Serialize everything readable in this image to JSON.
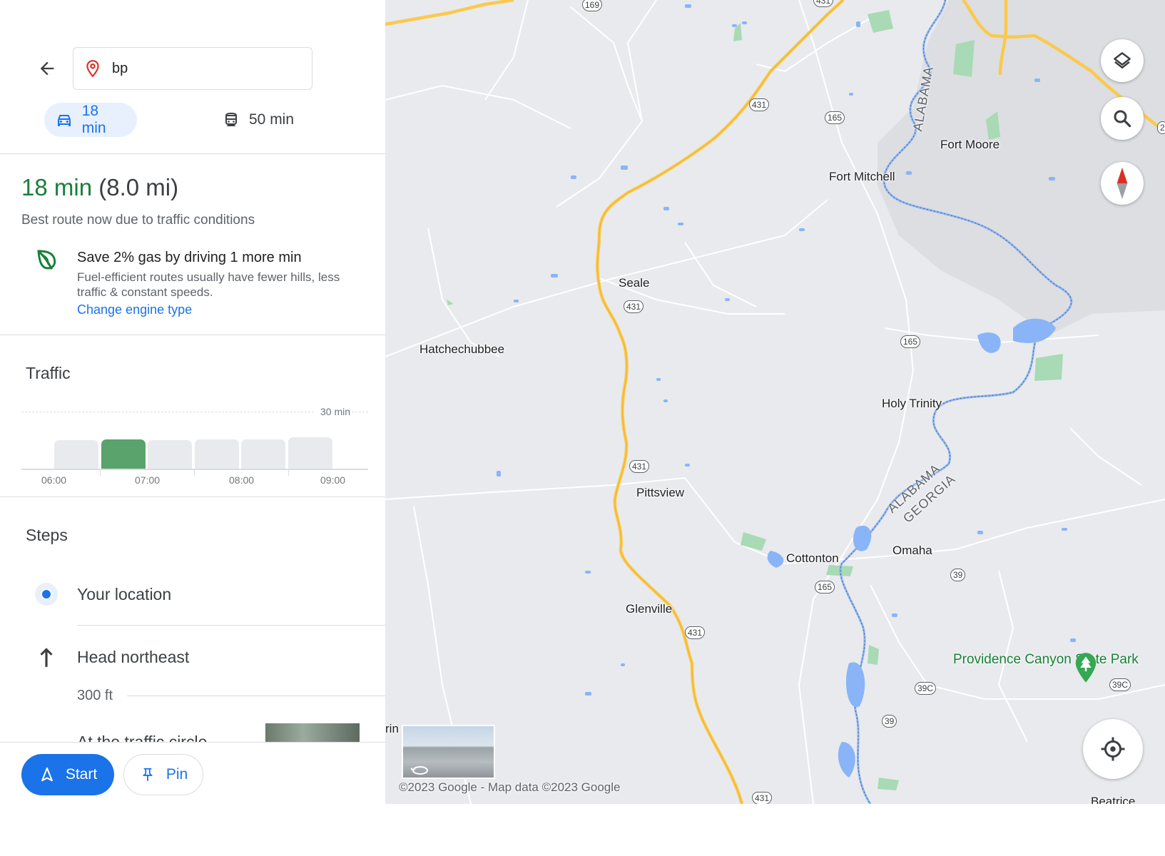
{
  "search": {
    "value": "bp",
    "placeholder": ""
  },
  "modes": [
    {
      "label": "18 min",
      "icon": "car-icon",
      "active": true
    },
    {
      "label": "50 min",
      "icon": "transit-icon",
      "active": false
    }
  ],
  "route": {
    "duration": "18 min",
    "distance": "(8.0 mi)",
    "note": "Best route now due to traffic conditions"
  },
  "eco": {
    "title": "Save 2% gas by driving 1 more min",
    "description": "Fuel-efficient routes usually have fewer hills, less traffic & constant speeds.",
    "link": "Change engine type",
    "icon": "leaf-icon"
  },
  "traffic": {
    "title": "Traffic",
    "max_label": "30 min",
    "time_labels": [
      "06:00",
      "07:00",
      "08:00",
      "09:00"
    ]
  },
  "chart_data": {
    "type": "bar",
    "title": "Traffic",
    "ylim": [
      0,
      30
    ],
    "x_ticks": [
      "06:00",
      "07:00",
      "08:00",
      "09:00"
    ],
    "values": [
      15,
      15.5,
      15,
      15.5,
      15.5,
      16.5
    ],
    "highlight_index": 1,
    "highlight_color": "#5aa36c",
    "bar_color": "#e8eaed"
  },
  "steps": {
    "title": "Steps",
    "items": [
      {
        "text": "Your location",
        "icon": "location-dot-icon"
      },
      {
        "text": "Head northeast",
        "icon": "arrow-up-icon",
        "distance": "300 ft"
      },
      {
        "text": "At the traffic circle"
      }
    ]
  },
  "actions": {
    "start": "Start",
    "pin": "Pin"
  },
  "map": {
    "places": [
      "Fort Moore",
      "Fort Mitchell",
      "Seale",
      "Hatchechubbee",
      "Holy Trinity",
      "Pittsview",
      "Cottonton",
      "Omaha",
      "Glenville",
      "Beatrice",
      "rin"
    ],
    "park": "Providence Canyon State Park",
    "route_shields": [
      "169",
      "431",
      "431",
      "165",
      "431",
      "165",
      "431",
      "165",
      "39",
      "431",
      "39C",
      "39C",
      "39",
      "431",
      "2"
    ],
    "state_labels": [
      "ALABAMA",
      "ALABAMA",
      "GEORGIA"
    ],
    "copyright": "©2023 Google - Map data ©2023 Google",
    "colors": {
      "land": "#e8eaed",
      "water": "#8ab4f8",
      "highway": "#fbc94c",
      "park": "#a8dab5"
    }
  }
}
